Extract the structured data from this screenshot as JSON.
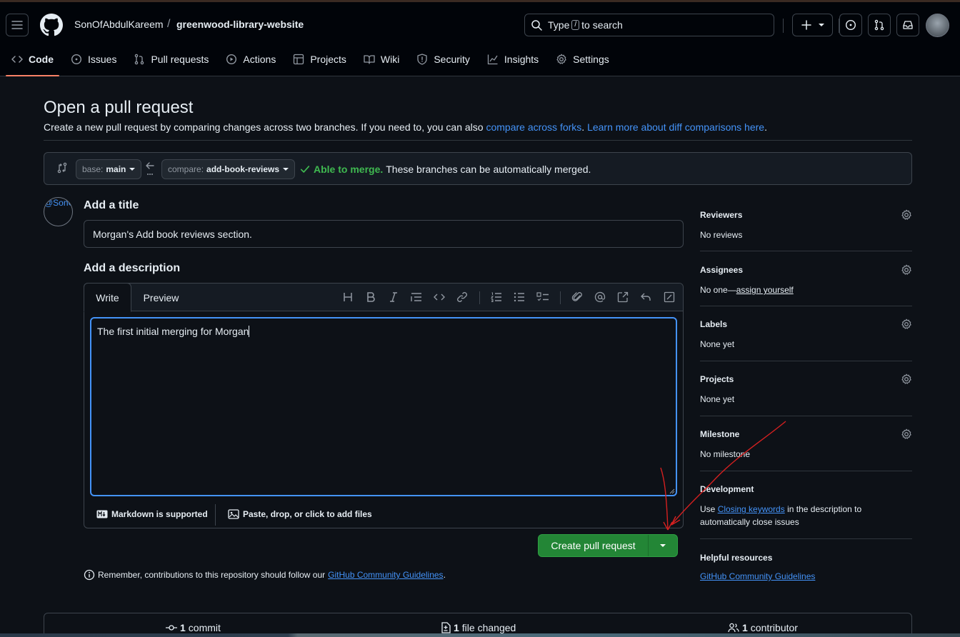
{
  "header": {
    "owner": "SonOfAbdulKareem",
    "separator": "/",
    "repo": "greenwood-library-website",
    "search_prefix": "Type",
    "search_key": "/",
    "search_suffix": "to search"
  },
  "tabs": [
    {
      "label": "Code",
      "icon": "code-icon"
    },
    {
      "label": "Issues",
      "icon": "issue-icon"
    },
    {
      "label": "Pull requests",
      "icon": "pull-request-icon"
    },
    {
      "label": "Actions",
      "icon": "play-icon"
    },
    {
      "label": "Projects",
      "icon": "table-icon"
    },
    {
      "label": "Wiki",
      "icon": "book-icon"
    },
    {
      "label": "Security",
      "icon": "shield-icon"
    },
    {
      "label": "Insights",
      "icon": "graph-icon"
    },
    {
      "label": "Settings",
      "icon": "gear-icon"
    }
  ],
  "page": {
    "title": "Open a pull request",
    "subtitle_text": "Create a new pull request by comparing changes across two branches. If you need to, you can also",
    "compare_forks_link": "compare across forks",
    "learn_more_link": "Learn more about diff comparisons here",
    "period": "."
  },
  "compare": {
    "base_key": "base:",
    "base_value": "main",
    "compare_key": "compare:",
    "compare_value": "add-book-reviews",
    "able": "Able to merge.",
    "able_msg": "These branches can be automatically merged."
  },
  "form": {
    "avatar_alt": "@SonOfAb",
    "title_label": "Add a title",
    "title_value": "Morgan's Add book reviews section.",
    "desc_label": "Add a description",
    "write_tab": "Write",
    "preview_tab": "Preview",
    "body_text": "The first initial merging for Morgan",
    "markdown_note": "Markdown is supported",
    "attach_note": "Paste, drop, or click to add files",
    "create_button": "Create pull request",
    "reminder_text": "Remember, contributions to this repository should follow our",
    "guidelines_link": "GitHub Community Guidelines",
    "reminder_end": "."
  },
  "sidebar": {
    "reviewers": {
      "title": "Reviewers",
      "value": "No reviews"
    },
    "assignees": {
      "title": "Assignees",
      "value": "No one—",
      "link": "assign yourself"
    },
    "labels": {
      "title": "Labels",
      "value": "None yet"
    },
    "projects": {
      "title": "Projects",
      "value": "None yet"
    },
    "milestone": {
      "title": "Milestone",
      "value": "No milestone"
    },
    "development": {
      "title": "Development",
      "prefix": "Use",
      "link": "Closing keywords",
      "suffix": "in the description to automatically close issues"
    },
    "helpful": {
      "title": "Helpful resources",
      "link": "GitHub Community Guidelines"
    }
  },
  "stats": {
    "commits_count": "1",
    "commits_label": "commit",
    "files_count": "1",
    "files_label": "file changed",
    "contributors_count": "1",
    "contributors_label": "contributor"
  },
  "colors": {
    "accent": "#4493f8",
    "success": "#3fb950",
    "button_green": "#238636",
    "tab_underline": "#f78166",
    "annotation_red": "#d42020"
  }
}
